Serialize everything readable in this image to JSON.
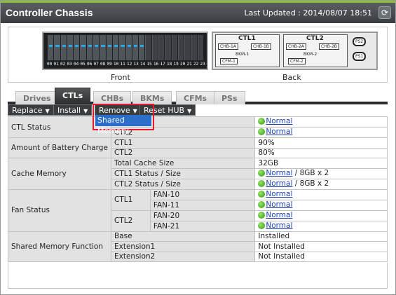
{
  "window": {
    "title": "Controller Chassis",
    "last_updated_label": "Last Updated :",
    "last_updated_value": "2014/08/07 18:51",
    "refresh_icon": "refresh-icon"
  },
  "chassis": {
    "front_label": "Front",
    "back_label": "Back",
    "slot_numbers": [
      "00",
      "01",
      "02",
      "03",
      "04",
      "05",
      "06",
      "07",
      "08",
      "09",
      "10",
      "11",
      "12",
      "13",
      "14",
      "15",
      "16",
      "17",
      "18",
      "19",
      "20",
      "21",
      "22",
      "23"
    ],
    "ctl1": {
      "name": "CTL1",
      "chb_a": "CHB-1A",
      "chb_b": "CHB-1B",
      "bkm": "BKM-1",
      "cfm": "CFM-1"
    },
    "ctl2": {
      "name": "CTL2",
      "chb_a": "CHB-2A",
      "chb_b": "CHB-2B",
      "bkm": "BKM-2",
      "cfm": "CFM-2"
    },
    "ps1": "PS1",
    "ps2": "PS2"
  },
  "tabs": [
    {
      "label": "Drives"
    },
    {
      "label": "CTLs",
      "active": true
    },
    {
      "label": "CHBs"
    },
    {
      "label": "BKMs"
    },
    {
      "label": "CFMs"
    },
    {
      "label": "PSs"
    }
  ],
  "toolbar": {
    "replace": "Replace",
    "install": "Install",
    "remove": "Remove",
    "reset_hub": "Reset HUB",
    "remove_menu": [
      "Shared Memory"
    ]
  },
  "table": {
    "ctl_status": {
      "label": "CTL Status",
      "ctl1": "CTL1",
      "ctl2": "CTL2",
      "v1": "Normal",
      "v2": "Normal"
    },
    "battery": {
      "label": "Amount of Battery Charge",
      "ctl1": "CTL1",
      "ctl2": "CTL2",
      "v1": "90%",
      "v2": "80%"
    },
    "cache": {
      "label": "Cache Memory",
      "total_label": "Total Cache Size",
      "total_value": "32GB",
      "ctl1_label": "CTL1 Status / Size",
      "ctl1_status": "Normal",
      "ctl1_size": " / 8GB x 2",
      "ctl2_label": "CTL2 Status / Size",
      "ctl2_status": "Normal",
      "ctl2_size": " / 8GB x 2"
    },
    "fan": {
      "label": "Fan Status",
      "ctl1": "CTL1",
      "ctl2": "CTL2",
      "fans": [
        {
          "name": "FAN-10",
          "status": "Normal"
        },
        {
          "name": "FAN-11",
          "status": "Normal"
        },
        {
          "name": "FAN-20",
          "status": "Normal"
        },
        {
          "name": "FAN-21",
          "status": "Normal"
        }
      ]
    },
    "shared_memory": {
      "label": "Shared Memory Function",
      "rows": [
        {
          "name": "Base",
          "value": "Installed"
        },
        {
          "name": "Extension1",
          "value": "Not Installed"
        },
        {
          "name": "Extension2",
          "value": "Not Installed"
        }
      ]
    }
  },
  "colors": {
    "accent": "#8bbf3a",
    "highlight": "#e21c2c",
    "menu_selected": "#2b6fcb",
    "status_ok": "#2c9a12"
  }
}
